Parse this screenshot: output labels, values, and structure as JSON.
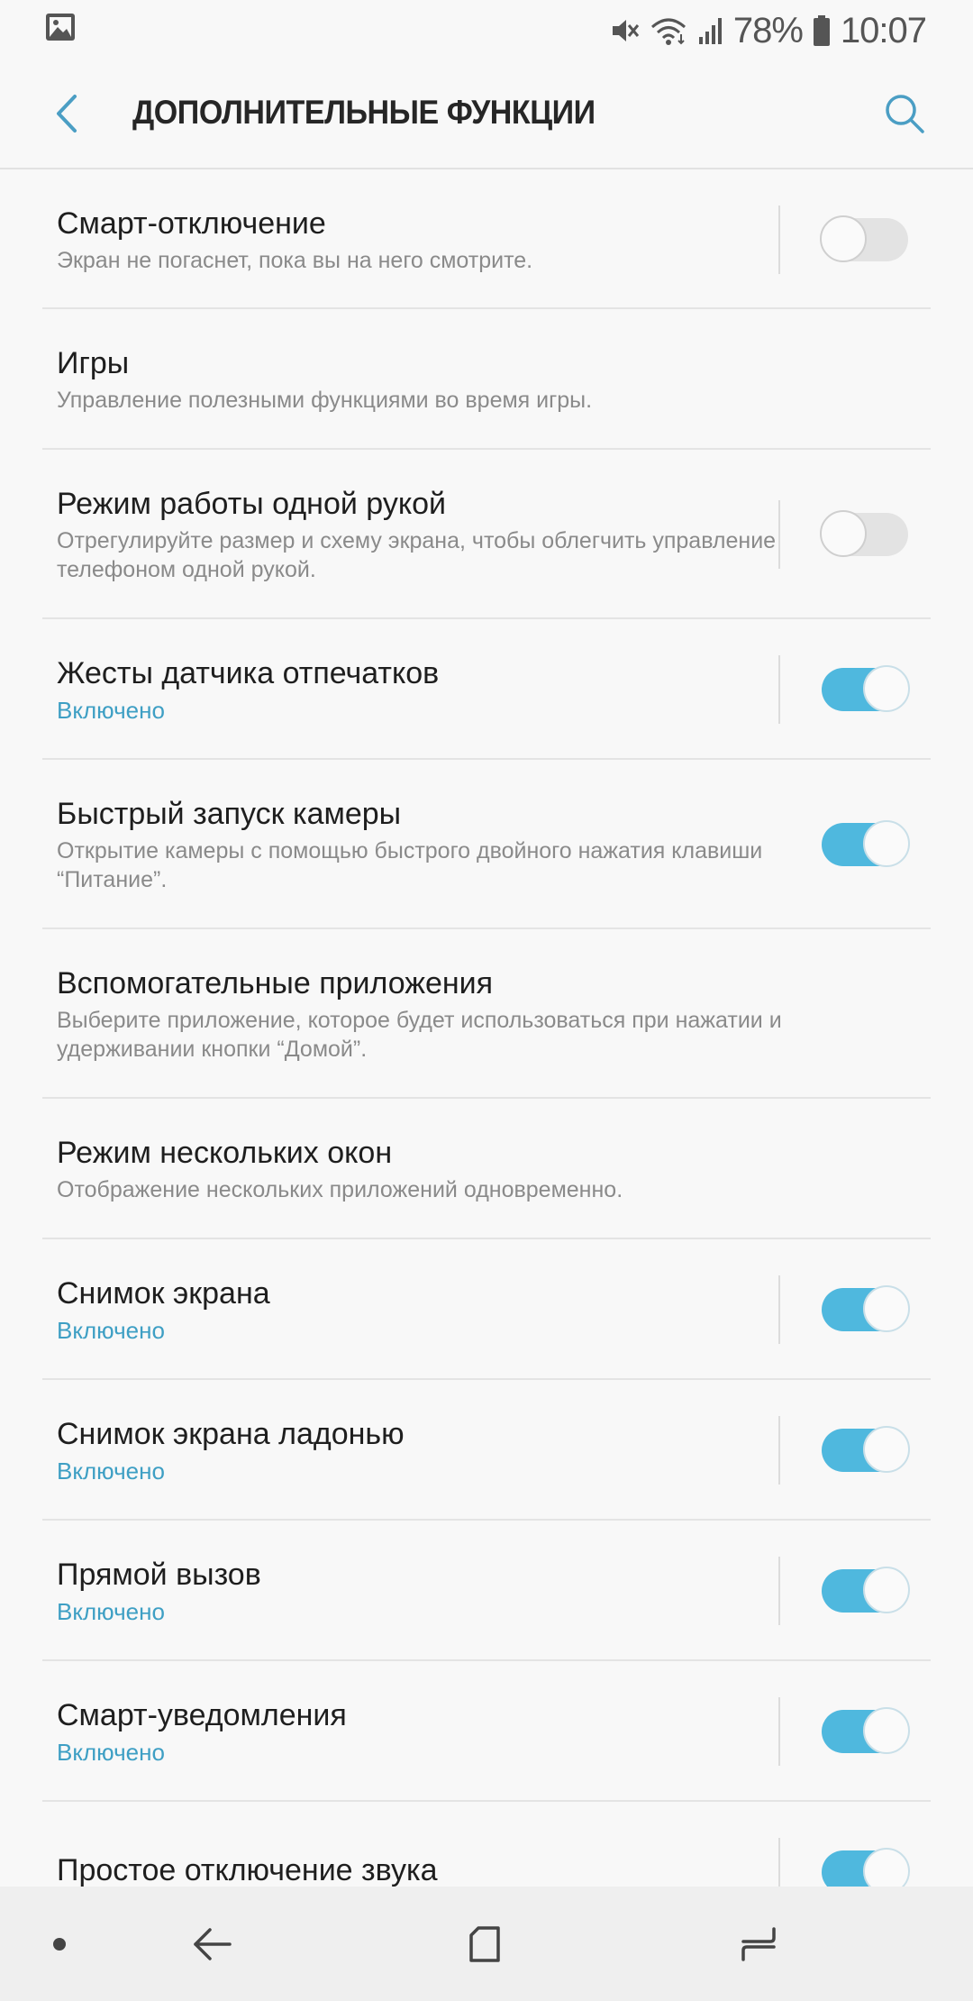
{
  "status_bar": {
    "battery": "78%",
    "time": "10:07"
  },
  "app_bar": {
    "title": "ДОПОЛНИТЕЛЬНЫЕ ФУНКЦИИ"
  },
  "items": [
    {
      "title": "Смарт-отключение",
      "subtitle": "Экран не погаснет, пока вы на него смотрите.",
      "toggle": "off"
    },
    {
      "title": "Игры",
      "subtitle": "Управление полезными функциями во время игры.",
      "toggle": null
    },
    {
      "title": "Режим работы одной рукой",
      "subtitle": "Отрегулируйте размер и схему экрана, чтобы облегчить управление телефоном одной рукой.",
      "toggle": "off"
    },
    {
      "title": "Жесты датчика отпечатков",
      "subtitle": "Включено",
      "toggle": "on"
    },
    {
      "title": "Быстрый запуск камеры",
      "subtitle": "Открытие камеры с помощью быстрого двойного нажатия клавиши “Питание”.",
      "toggle": "on"
    },
    {
      "title": "Вспомогательные приложения",
      "subtitle": "Выберите приложение, которое будет использоваться при нажатии и удерживании кнопки “Домой”.",
      "toggle": null
    },
    {
      "title": "Режим нескольких окон",
      "subtitle": "Отображение нескольких приложений одновременно.",
      "toggle": null
    },
    {
      "title": "Снимок экрана",
      "subtitle": "Включено",
      "toggle": "on"
    },
    {
      "title": "Снимок экрана ладонью",
      "subtitle": "Включено",
      "toggle": "on"
    },
    {
      "title": "Прямой вызов",
      "subtitle": "Включено",
      "toggle": "on"
    },
    {
      "title": "Смарт-уведомления",
      "subtitle": "Включено",
      "toggle": "on"
    },
    {
      "title": "Простое отключение звука",
      "subtitle": "",
      "toggle": "on"
    }
  ],
  "colors": {
    "accent": "#4fb8de",
    "on_text": "#3e9fc4",
    "back_icon": "#4b9ec4"
  },
  "icons": {
    "status_left": "gallery-icon",
    "status_right": [
      "mute-icon",
      "wifi-icon",
      "signal-icon",
      "battery-icon"
    ],
    "nav": [
      "dot-icon",
      "back-arrow-icon",
      "home-square-icon",
      "recents-icon"
    ]
  }
}
